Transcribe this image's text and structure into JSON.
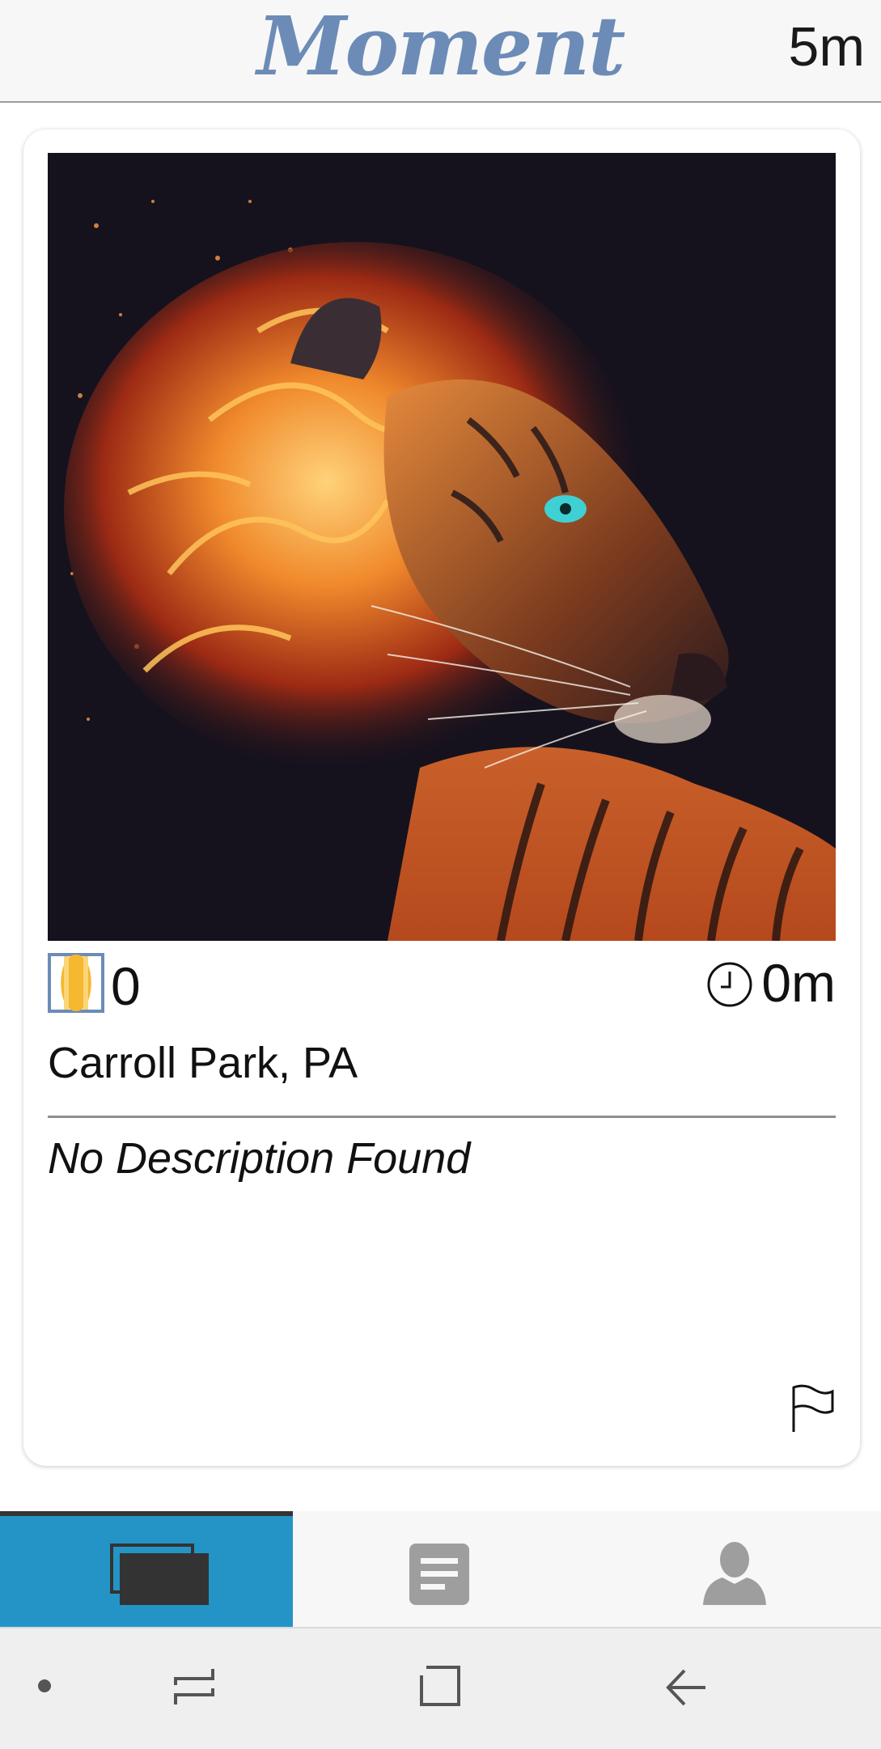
{
  "header": {
    "app_title": "Moment",
    "elapsed_time": "5m"
  },
  "post": {
    "image_subject": "tiger with fiery mane",
    "vote_count": "0",
    "age": "0m",
    "location": "Carroll Park, PA",
    "description": "No Description Found"
  },
  "icons": {
    "vote": "vote-meter-icon",
    "clock": "clock-icon",
    "flag": "flag-icon",
    "feed_tab": "stacked-cards-icon",
    "list_tab": "document-icon",
    "profile_tab": "person-icon",
    "nav_dot": "dot-icon",
    "nav_recents": "recents-icon",
    "nav_home": "home-square-icon",
    "nav_back": "back-arrow-icon"
  },
  "tabs": [
    {
      "id": "feed",
      "active": true
    },
    {
      "id": "list",
      "active": false
    },
    {
      "id": "profile",
      "active": false
    }
  ],
  "colors": {
    "accent": "#2494c6",
    "logo": "#6c8cb7",
    "vote_fill": "#f5b82e",
    "vote_border": "#6c8cb7",
    "tab_icon": "#9e9e9e",
    "tab_icon_active": "#333333"
  }
}
